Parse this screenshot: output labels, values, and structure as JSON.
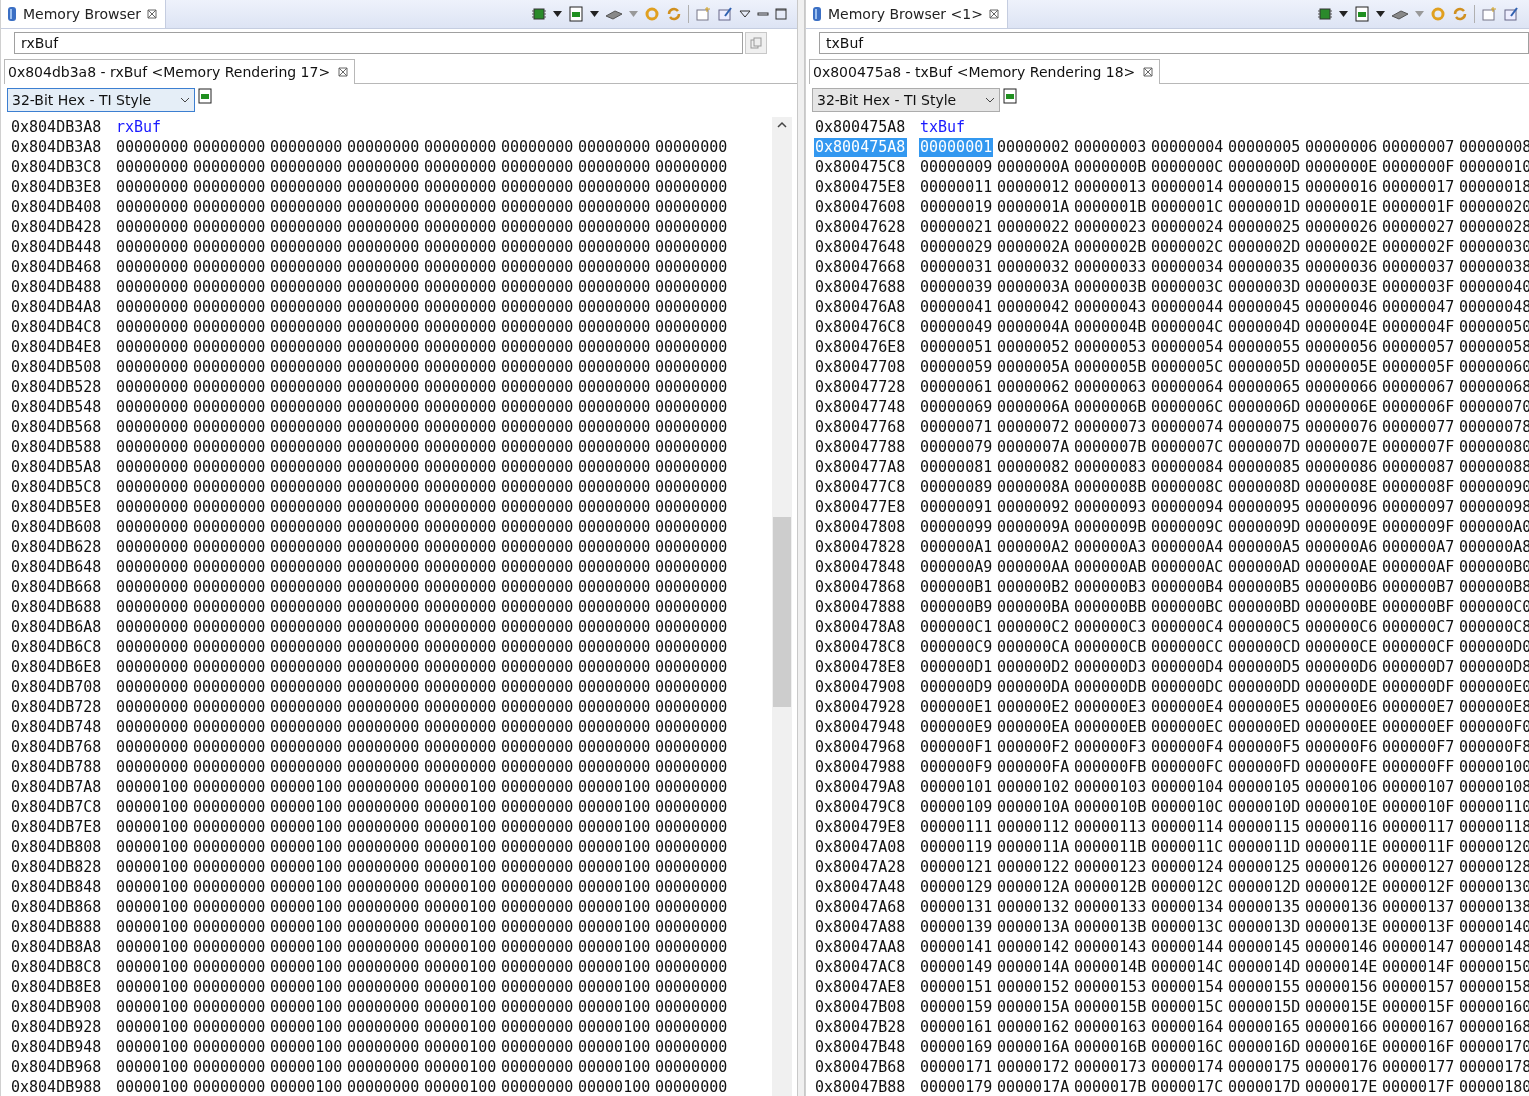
{
  "panes": [
    {
      "view_tab": {
        "label": "Memory Browser",
        "selected": true
      },
      "window_controls": true,
      "address_field": {
        "value": "rxBuf"
      },
      "rendering_tab": {
        "label": "0x804db3a8 - rxBuf <Memory Rendering 17>",
        "selected": true
      },
      "format": "32-Bit Hex - TI Style",
      "label_row": {
        "address": "0x804DB3A8",
        "label": "rxBuf"
      },
      "scrollbar": true,
      "rows": [
        {
          "address": "0x804DB3A8",
          "selected": false,
          "cells": [
            "00000000",
            "00000000",
            "00000000",
            "00000000",
            "00000000",
            "00000000",
            "00000000",
            "00000000"
          ]
        },
        {
          "address": "0x804DB3C8",
          "selected": false,
          "cells": [
            "00000000",
            "00000000",
            "00000000",
            "00000000",
            "00000000",
            "00000000",
            "00000000",
            "00000000"
          ]
        },
        {
          "address": "0x804DB3E8",
          "selected": false,
          "cells": [
            "00000000",
            "00000000",
            "00000000",
            "00000000",
            "00000000",
            "00000000",
            "00000000",
            "00000000"
          ]
        },
        {
          "address": "0x804DB408",
          "selected": false,
          "cells": [
            "00000000",
            "00000000",
            "00000000",
            "00000000",
            "00000000",
            "00000000",
            "00000000",
            "00000000"
          ]
        },
        {
          "address": "0x804DB428",
          "selected": false,
          "cells": [
            "00000000",
            "00000000",
            "00000000",
            "00000000",
            "00000000",
            "00000000",
            "00000000",
            "00000000"
          ]
        },
        {
          "address": "0x804DB448",
          "selected": false,
          "cells": [
            "00000000",
            "00000000",
            "00000000",
            "00000000",
            "00000000",
            "00000000",
            "00000000",
            "00000000"
          ]
        },
        {
          "address": "0x804DB468",
          "selected": false,
          "cells": [
            "00000000",
            "00000000",
            "00000000",
            "00000000",
            "00000000",
            "00000000",
            "00000000",
            "00000000"
          ]
        },
        {
          "address": "0x804DB488",
          "selected": false,
          "cells": [
            "00000000",
            "00000000",
            "00000000",
            "00000000",
            "00000000",
            "00000000",
            "00000000",
            "00000000"
          ]
        },
        {
          "address": "0x804DB4A8",
          "selected": false,
          "cells": [
            "00000000",
            "00000000",
            "00000000",
            "00000000",
            "00000000",
            "00000000",
            "00000000",
            "00000000"
          ]
        },
        {
          "address": "0x804DB4C8",
          "selected": false,
          "cells": [
            "00000000",
            "00000000",
            "00000000",
            "00000000",
            "00000000",
            "00000000",
            "00000000",
            "00000000"
          ]
        },
        {
          "address": "0x804DB4E8",
          "selected": false,
          "cells": [
            "00000000",
            "00000000",
            "00000000",
            "00000000",
            "00000000",
            "00000000",
            "00000000",
            "00000000"
          ]
        },
        {
          "address": "0x804DB508",
          "selected": false,
          "cells": [
            "00000000",
            "00000000",
            "00000000",
            "00000000",
            "00000000",
            "00000000",
            "00000000",
            "00000000"
          ]
        },
        {
          "address": "0x804DB528",
          "selected": false,
          "cells": [
            "00000000",
            "00000000",
            "00000000",
            "00000000",
            "00000000",
            "00000000",
            "00000000",
            "00000000"
          ]
        },
        {
          "address": "0x804DB548",
          "selected": false,
          "cells": [
            "00000000",
            "00000000",
            "00000000",
            "00000000",
            "00000000",
            "00000000",
            "00000000",
            "00000000"
          ]
        },
        {
          "address": "0x804DB568",
          "selected": false,
          "cells": [
            "00000000",
            "00000000",
            "00000000",
            "00000000",
            "00000000",
            "00000000",
            "00000000",
            "00000000"
          ]
        },
        {
          "address": "0x804DB588",
          "selected": false,
          "cells": [
            "00000000",
            "00000000",
            "00000000",
            "00000000",
            "00000000",
            "00000000",
            "00000000",
            "00000000"
          ]
        },
        {
          "address": "0x804DB5A8",
          "selected": false,
          "cells": [
            "00000000",
            "00000000",
            "00000000",
            "00000000",
            "00000000",
            "00000000",
            "00000000",
            "00000000"
          ]
        },
        {
          "address": "0x804DB5C8",
          "selected": false,
          "cells": [
            "00000000",
            "00000000",
            "00000000",
            "00000000",
            "00000000",
            "00000000",
            "00000000",
            "00000000"
          ]
        },
        {
          "address": "0x804DB5E8",
          "selected": false,
          "cells": [
            "00000000",
            "00000000",
            "00000000",
            "00000000",
            "00000000",
            "00000000",
            "00000000",
            "00000000"
          ]
        },
        {
          "address": "0x804DB608",
          "selected": false,
          "cells": [
            "00000000",
            "00000000",
            "00000000",
            "00000000",
            "00000000",
            "00000000",
            "00000000",
            "00000000"
          ]
        },
        {
          "address": "0x804DB628",
          "selected": false,
          "cells": [
            "00000000",
            "00000000",
            "00000000",
            "00000000",
            "00000000",
            "00000000",
            "00000000",
            "00000000"
          ]
        },
        {
          "address": "0x804DB648",
          "selected": false,
          "cells": [
            "00000000",
            "00000000",
            "00000000",
            "00000000",
            "00000000",
            "00000000",
            "00000000",
            "00000000"
          ]
        },
        {
          "address": "0x804DB668",
          "selected": false,
          "cells": [
            "00000000",
            "00000000",
            "00000000",
            "00000000",
            "00000000",
            "00000000",
            "00000000",
            "00000000"
          ]
        },
        {
          "address": "0x804DB688",
          "selected": false,
          "cells": [
            "00000000",
            "00000000",
            "00000000",
            "00000000",
            "00000000",
            "00000000",
            "00000000",
            "00000000"
          ]
        },
        {
          "address": "0x804DB6A8",
          "selected": false,
          "cells": [
            "00000000",
            "00000000",
            "00000000",
            "00000000",
            "00000000",
            "00000000",
            "00000000",
            "00000000"
          ]
        },
        {
          "address": "0x804DB6C8",
          "selected": false,
          "cells": [
            "00000000",
            "00000000",
            "00000000",
            "00000000",
            "00000000",
            "00000000",
            "00000000",
            "00000000"
          ]
        },
        {
          "address": "0x804DB6E8",
          "selected": false,
          "cells": [
            "00000000",
            "00000000",
            "00000000",
            "00000000",
            "00000000",
            "00000000",
            "00000000",
            "00000000"
          ]
        },
        {
          "address": "0x804DB708",
          "selected": false,
          "cells": [
            "00000000",
            "00000000",
            "00000000",
            "00000000",
            "00000000",
            "00000000",
            "00000000",
            "00000000"
          ]
        },
        {
          "address": "0x804DB728",
          "selected": false,
          "cells": [
            "00000000",
            "00000000",
            "00000000",
            "00000000",
            "00000000",
            "00000000",
            "00000000",
            "00000000"
          ]
        },
        {
          "address": "0x804DB748",
          "selected": false,
          "cells": [
            "00000000",
            "00000000",
            "00000000",
            "00000000",
            "00000000",
            "00000000",
            "00000000",
            "00000000"
          ]
        },
        {
          "address": "0x804DB768",
          "selected": false,
          "cells": [
            "00000000",
            "00000000",
            "00000000",
            "00000000",
            "00000000",
            "00000000",
            "00000000",
            "00000000"
          ]
        },
        {
          "address": "0x804DB788",
          "selected": false,
          "cells": [
            "00000000",
            "00000000",
            "00000000",
            "00000000",
            "00000000",
            "00000000",
            "00000000",
            "00000000"
          ]
        },
        {
          "address": "0x804DB7A8",
          "selected": false,
          "cells": [
            "00000100",
            "00000000",
            "00000100",
            "00000000",
            "00000100",
            "00000000",
            "00000100",
            "00000000"
          ]
        },
        {
          "address": "0x804DB7C8",
          "selected": false,
          "cells": [
            "00000100",
            "00000000",
            "00000100",
            "00000000",
            "00000100",
            "00000000",
            "00000100",
            "00000000"
          ]
        },
        {
          "address": "0x804DB7E8",
          "selected": false,
          "cells": [
            "00000100",
            "00000000",
            "00000100",
            "00000000",
            "00000100",
            "00000000",
            "00000100",
            "00000000"
          ]
        },
        {
          "address": "0x804DB808",
          "selected": false,
          "cells": [
            "00000100",
            "00000000",
            "00000100",
            "00000000",
            "00000100",
            "00000000",
            "00000100",
            "00000000"
          ]
        },
        {
          "address": "0x804DB828",
          "selected": false,
          "cells": [
            "00000100",
            "00000000",
            "00000100",
            "00000000",
            "00000100",
            "00000000",
            "00000100",
            "00000000"
          ]
        },
        {
          "address": "0x804DB848",
          "selected": false,
          "cells": [
            "00000100",
            "00000000",
            "00000100",
            "00000000",
            "00000100",
            "00000000",
            "00000100",
            "00000000"
          ]
        },
        {
          "address": "0x804DB868",
          "selected": false,
          "cells": [
            "00000100",
            "00000000",
            "00000100",
            "00000000",
            "00000100",
            "00000000",
            "00000100",
            "00000000"
          ]
        },
        {
          "address": "0x804DB888",
          "selected": false,
          "cells": [
            "00000100",
            "00000000",
            "00000100",
            "00000000",
            "00000100",
            "00000000",
            "00000100",
            "00000000"
          ]
        },
        {
          "address": "0x804DB8A8",
          "selected": false,
          "cells": [
            "00000100",
            "00000000",
            "00000100",
            "00000000",
            "00000100",
            "00000000",
            "00000100",
            "00000000"
          ]
        },
        {
          "address": "0x804DB8C8",
          "selected": false,
          "cells": [
            "00000100",
            "00000000",
            "00000100",
            "00000000",
            "00000100",
            "00000000",
            "00000100",
            "00000000"
          ]
        },
        {
          "address": "0x804DB8E8",
          "selected": false,
          "cells": [
            "00000100",
            "00000000",
            "00000100",
            "00000000",
            "00000100",
            "00000000",
            "00000100",
            "00000000"
          ]
        },
        {
          "address": "0x804DB908",
          "selected": false,
          "cells": [
            "00000100",
            "00000000",
            "00000100",
            "00000000",
            "00000100",
            "00000000",
            "00000100",
            "00000000"
          ]
        },
        {
          "address": "0x804DB928",
          "selected": false,
          "cells": [
            "00000100",
            "00000000",
            "00000100",
            "00000000",
            "00000100",
            "00000000",
            "00000100",
            "00000000"
          ]
        },
        {
          "address": "0x804DB948",
          "selected": false,
          "cells": [
            "00000100",
            "00000000",
            "00000100",
            "00000000",
            "00000100",
            "00000000",
            "00000100",
            "00000000"
          ]
        },
        {
          "address": "0x804DB968",
          "selected": false,
          "cells": [
            "00000100",
            "00000000",
            "00000100",
            "00000000",
            "00000100",
            "00000000",
            "00000100",
            "00000000"
          ]
        },
        {
          "address": "0x804DB988",
          "selected": false,
          "cells": [
            "00000100",
            "00000000",
            "00000100",
            "00000000",
            "00000100",
            "00000000",
            "00000100",
            "00000000"
          ]
        }
      ]
    },
    {
      "view_tab": {
        "label": "Memory Browser <1>",
        "selected": true
      },
      "window_controls": false,
      "address_field": {
        "value": "txBuf"
      },
      "rendering_tab": {
        "label": "0x800475a8 - txBuf <Memory Rendering 18>",
        "selected": true
      },
      "format": "32-Bit Hex - TI Style",
      "label_row": {
        "address": "0x800475A8",
        "label": "txBuf"
      },
      "scrollbar": false,
      "rows": [
        {
          "address": "0x800475A8",
          "selected": true,
          "cells": [
            "00000001",
            "00000002",
            "00000003",
            "00000004",
            "00000005",
            "00000006",
            "00000007",
            "00000008"
          ]
        },
        {
          "address": "0x800475C8",
          "selected": false,
          "cells": [
            "00000009",
            "0000000A",
            "0000000B",
            "0000000C",
            "0000000D",
            "0000000E",
            "0000000F",
            "00000010"
          ]
        },
        {
          "address": "0x800475E8",
          "selected": false,
          "cells": [
            "00000011",
            "00000012",
            "00000013",
            "00000014",
            "00000015",
            "00000016",
            "00000017",
            "00000018"
          ]
        },
        {
          "address": "0x80047608",
          "selected": false,
          "cells": [
            "00000019",
            "0000001A",
            "0000001B",
            "0000001C",
            "0000001D",
            "0000001E",
            "0000001F",
            "00000020"
          ]
        },
        {
          "address": "0x80047628",
          "selected": false,
          "cells": [
            "00000021",
            "00000022",
            "00000023",
            "00000024",
            "00000025",
            "00000026",
            "00000027",
            "00000028"
          ]
        },
        {
          "address": "0x80047648",
          "selected": false,
          "cells": [
            "00000029",
            "0000002A",
            "0000002B",
            "0000002C",
            "0000002D",
            "0000002E",
            "0000002F",
            "00000030"
          ]
        },
        {
          "address": "0x80047668",
          "selected": false,
          "cells": [
            "00000031",
            "00000032",
            "00000033",
            "00000034",
            "00000035",
            "00000036",
            "00000037",
            "00000038"
          ]
        },
        {
          "address": "0x80047688",
          "selected": false,
          "cells": [
            "00000039",
            "0000003A",
            "0000003B",
            "0000003C",
            "0000003D",
            "0000003E",
            "0000003F",
            "00000040"
          ]
        },
        {
          "address": "0x800476A8",
          "selected": false,
          "cells": [
            "00000041",
            "00000042",
            "00000043",
            "00000044",
            "00000045",
            "00000046",
            "00000047",
            "00000048"
          ]
        },
        {
          "address": "0x800476C8",
          "selected": false,
          "cells": [
            "00000049",
            "0000004A",
            "0000004B",
            "0000004C",
            "0000004D",
            "0000004E",
            "0000004F",
            "00000050"
          ]
        },
        {
          "address": "0x800476E8",
          "selected": false,
          "cells": [
            "00000051",
            "00000052",
            "00000053",
            "00000054",
            "00000055",
            "00000056",
            "00000057",
            "00000058"
          ]
        },
        {
          "address": "0x80047708",
          "selected": false,
          "cells": [
            "00000059",
            "0000005A",
            "0000005B",
            "0000005C",
            "0000005D",
            "0000005E",
            "0000005F",
            "00000060"
          ]
        },
        {
          "address": "0x80047728",
          "selected": false,
          "cells": [
            "00000061",
            "00000062",
            "00000063",
            "00000064",
            "00000065",
            "00000066",
            "00000067",
            "00000068"
          ]
        },
        {
          "address": "0x80047748",
          "selected": false,
          "cells": [
            "00000069",
            "0000006A",
            "0000006B",
            "0000006C",
            "0000006D",
            "0000006E",
            "0000006F",
            "00000070"
          ]
        },
        {
          "address": "0x80047768",
          "selected": false,
          "cells": [
            "00000071",
            "00000072",
            "00000073",
            "00000074",
            "00000075",
            "00000076",
            "00000077",
            "00000078"
          ]
        },
        {
          "address": "0x80047788",
          "selected": false,
          "cells": [
            "00000079",
            "0000007A",
            "0000007B",
            "0000007C",
            "0000007D",
            "0000007E",
            "0000007F",
            "00000080"
          ]
        },
        {
          "address": "0x800477A8",
          "selected": false,
          "cells": [
            "00000081",
            "00000082",
            "00000083",
            "00000084",
            "00000085",
            "00000086",
            "00000087",
            "00000088"
          ]
        },
        {
          "address": "0x800477C8",
          "selected": false,
          "cells": [
            "00000089",
            "0000008A",
            "0000008B",
            "0000008C",
            "0000008D",
            "0000008E",
            "0000008F",
            "00000090"
          ]
        },
        {
          "address": "0x800477E8",
          "selected": false,
          "cells": [
            "00000091",
            "00000092",
            "00000093",
            "00000094",
            "00000095",
            "00000096",
            "00000097",
            "00000098"
          ]
        },
        {
          "address": "0x80047808",
          "selected": false,
          "cells": [
            "00000099",
            "0000009A",
            "0000009B",
            "0000009C",
            "0000009D",
            "0000009E",
            "0000009F",
            "000000A0"
          ]
        },
        {
          "address": "0x80047828",
          "selected": false,
          "cells": [
            "000000A1",
            "000000A2",
            "000000A3",
            "000000A4",
            "000000A5",
            "000000A6",
            "000000A7",
            "000000A8"
          ]
        },
        {
          "address": "0x80047848",
          "selected": false,
          "cells": [
            "000000A9",
            "000000AA",
            "000000AB",
            "000000AC",
            "000000AD",
            "000000AE",
            "000000AF",
            "000000B0"
          ]
        },
        {
          "address": "0x80047868",
          "selected": false,
          "cells": [
            "000000B1",
            "000000B2",
            "000000B3",
            "000000B4",
            "000000B5",
            "000000B6",
            "000000B7",
            "000000B8"
          ]
        },
        {
          "address": "0x80047888",
          "selected": false,
          "cells": [
            "000000B9",
            "000000BA",
            "000000BB",
            "000000BC",
            "000000BD",
            "000000BE",
            "000000BF",
            "000000C0"
          ]
        },
        {
          "address": "0x800478A8",
          "selected": false,
          "cells": [
            "000000C1",
            "000000C2",
            "000000C3",
            "000000C4",
            "000000C5",
            "000000C6",
            "000000C7",
            "000000C8"
          ]
        },
        {
          "address": "0x800478C8",
          "selected": false,
          "cells": [
            "000000C9",
            "000000CA",
            "000000CB",
            "000000CC",
            "000000CD",
            "000000CE",
            "000000CF",
            "000000D0"
          ]
        },
        {
          "address": "0x800478E8",
          "selected": false,
          "cells": [
            "000000D1",
            "000000D2",
            "000000D3",
            "000000D4",
            "000000D5",
            "000000D6",
            "000000D7",
            "000000D8"
          ]
        },
        {
          "address": "0x80047908",
          "selected": false,
          "cells": [
            "000000D9",
            "000000DA",
            "000000DB",
            "000000DC",
            "000000DD",
            "000000DE",
            "000000DF",
            "000000E0"
          ]
        },
        {
          "address": "0x80047928",
          "selected": false,
          "cells": [
            "000000E1",
            "000000E2",
            "000000E3",
            "000000E4",
            "000000E5",
            "000000E6",
            "000000E7",
            "000000E8"
          ]
        },
        {
          "address": "0x80047948",
          "selected": false,
          "cells": [
            "000000E9",
            "000000EA",
            "000000EB",
            "000000EC",
            "000000ED",
            "000000EE",
            "000000EF",
            "000000F0"
          ]
        },
        {
          "address": "0x80047968",
          "selected": false,
          "cells": [
            "000000F1",
            "000000F2",
            "000000F3",
            "000000F4",
            "000000F5",
            "000000F6",
            "000000F7",
            "000000F8"
          ]
        },
        {
          "address": "0x80047988",
          "selected": false,
          "cells": [
            "000000F9",
            "000000FA",
            "000000FB",
            "000000FC",
            "000000FD",
            "000000FE",
            "000000FF",
            "00000100"
          ]
        },
        {
          "address": "0x800479A8",
          "selected": false,
          "cells": [
            "00000101",
            "00000102",
            "00000103",
            "00000104",
            "00000105",
            "00000106",
            "00000107",
            "00000108"
          ]
        },
        {
          "address": "0x800479C8",
          "selected": false,
          "cells": [
            "00000109",
            "0000010A",
            "0000010B",
            "0000010C",
            "0000010D",
            "0000010E",
            "0000010F",
            "00000110"
          ]
        },
        {
          "address": "0x800479E8",
          "selected": false,
          "cells": [
            "00000111",
            "00000112",
            "00000113",
            "00000114",
            "00000115",
            "00000116",
            "00000117",
            "00000118"
          ]
        },
        {
          "address": "0x80047A08",
          "selected": false,
          "cells": [
            "00000119",
            "0000011A",
            "0000011B",
            "0000011C",
            "0000011D",
            "0000011E",
            "0000011F",
            "00000120"
          ]
        },
        {
          "address": "0x80047A28",
          "selected": false,
          "cells": [
            "00000121",
            "00000122",
            "00000123",
            "00000124",
            "00000125",
            "00000126",
            "00000127",
            "00000128"
          ]
        },
        {
          "address": "0x80047A48",
          "selected": false,
          "cells": [
            "00000129",
            "0000012A",
            "0000012B",
            "0000012C",
            "0000012D",
            "0000012E",
            "0000012F",
            "00000130"
          ]
        },
        {
          "address": "0x80047A68",
          "selected": false,
          "cells": [
            "00000131",
            "00000132",
            "00000133",
            "00000134",
            "00000135",
            "00000136",
            "00000137",
            "00000138"
          ]
        },
        {
          "address": "0x80047A88",
          "selected": false,
          "cells": [
            "00000139",
            "0000013A",
            "0000013B",
            "0000013C",
            "0000013D",
            "0000013E",
            "0000013F",
            "00000140"
          ]
        },
        {
          "address": "0x80047AA8",
          "selected": false,
          "cells": [
            "00000141",
            "00000142",
            "00000143",
            "00000144",
            "00000145",
            "00000146",
            "00000147",
            "00000148"
          ]
        },
        {
          "address": "0x80047AC8",
          "selected": false,
          "cells": [
            "00000149",
            "0000014A",
            "0000014B",
            "0000014C",
            "0000014D",
            "0000014E",
            "0000014F",
            "00000150"
          ]
        },
        {
          "address": "0x80047AE8",
          "selected": false,
          "cells": [
            "00000151",
            "00000152",
            "00000153",
            "00000154",
            "00000155",
            "00000156",
            "00000157",
            "00000158"
          ]
        },
        {
          "address": "0x80047B08",
          "selected": false,
          "cells": [
            "00000159",
            "0000015A",
            "0000015B",
            "0000015C",
            "0000015D",
            "0000015E",
            "0000015F",
            "00000160"
          ]
        },
        {
          "address": "0x80047B28",
          "selected": false,
          "cells": [
            "00000161",
            "00000162",
            "00000163",
            "00000164",
            "00000165",
            "00000166",
            "00000167",
            "00000168"
          ]
        },
        {
          "address": "0x80047B48",
          "selected": false,
          "cells": [
            "00000169",
            "0000016A",
            "0000016B",
            "0000016C",
            "0000016D",
            "0000016E",
            "0000016F",
            "00000170"
          ]
        },
        {
          "address": "0x80047B68",
          "selected": false,
          "cells": [
            "00000171",
            "00000172",
            "00000173",
            "00000174",
            "00000175",
            "00000176",
            "00000177",
            "00000178"
          ]
        },
        {
          "address": "0x80047B88",
          "selected": false,
          "cells": [
            "00000179",
            "0000017A",
            "0000017B",
            "0000017C",
            "0000017D",
            "0000017E",
            "0000017F",
            "00000180"
          ]
        }
      ]
    }
  ]
}
